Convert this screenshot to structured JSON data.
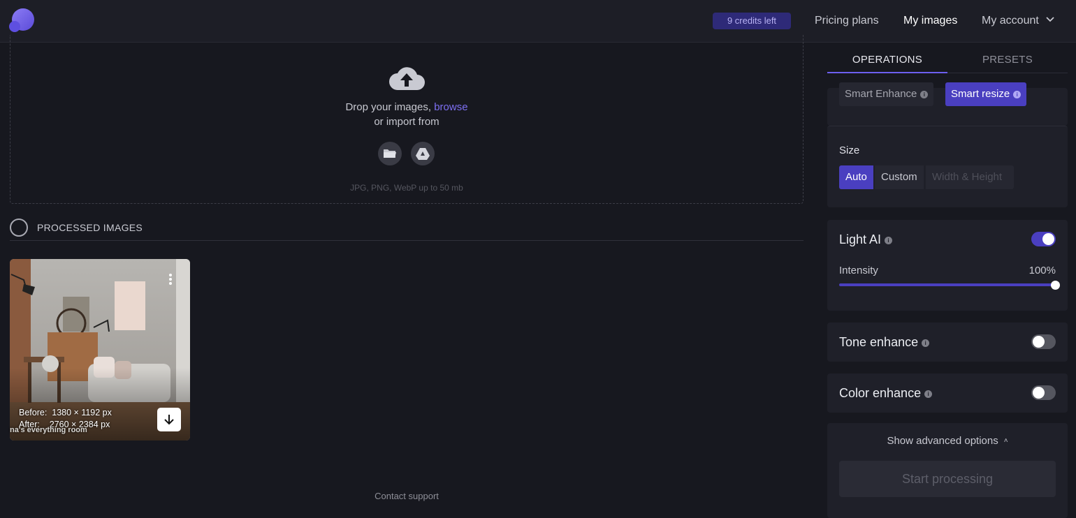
{
  "header": {
    "logo": "app-logo",
    "credits_badge": "9 credits left",
    "nav": {
      "pricing": "Pricing plans",
      "images": "My images",
      "account": "My account"
    },
    "account_icon": "chevron-down-icon"
  },
  "upload": {
    "cloud_icon": "cloud-upload-icon",
    "drop_prefix": "Drop your images,",
    "browse": "browse",
    "import_line": "or import from",
    "sources": [
      "folder-icon",
      "google-drive-icon"
    ],
    "formats": "JPG, PNG, WebP up to 50 mb"
  },
  "processed": {
    "title": "PROCESSED IMAGES",
    "card": {
      "before_label": "Before:",
      "before_value": "1380 × 1192 px",
      "after_label": "After:",
      "after_value": "2760 × 2384 px",
      "caption": "na's everything room",
      "menu_icon": "more-vertical-icon",
      "download_icon": "download-arrow-icon"
    }
  },
  "footer": {
    "contact": "Contact support"
  },
  "panel": {
    "tabs": [
      "OPERATIONS",
      "PRESETS"
    ],
    "active_tab": "OPERATIONS",
    "modes": {
      "enhance": "Smart Enhance",
      "resize": "Smart resize",
      "active": "Smart resize"
    },
    "size": {
      "label": "Size",
      "options": [
        "Auto",
        "Custom",
        "Width & Height"
      ],
      "selected": "Auto"
    },
    "light_ai": {
      "title": "Light AI",
      "enabled": true,
      "intensity_label": "Intensity",
      "intensity_value": "100%",
      "intensity": 1.0
    },
    "tone": {
      "title": "Tone enhance",
      "enabled": false
    },
    "color": {
      "title": "Color enhance",
      "enabled": false
    },
    "advanced": "Show advanced options",
    "start": "Start processing"
  },
  "colors": {
    "accent": "#4a3fc0",
    "link": "#7d6ff2",
    "background": "#17181f"
  }
}
